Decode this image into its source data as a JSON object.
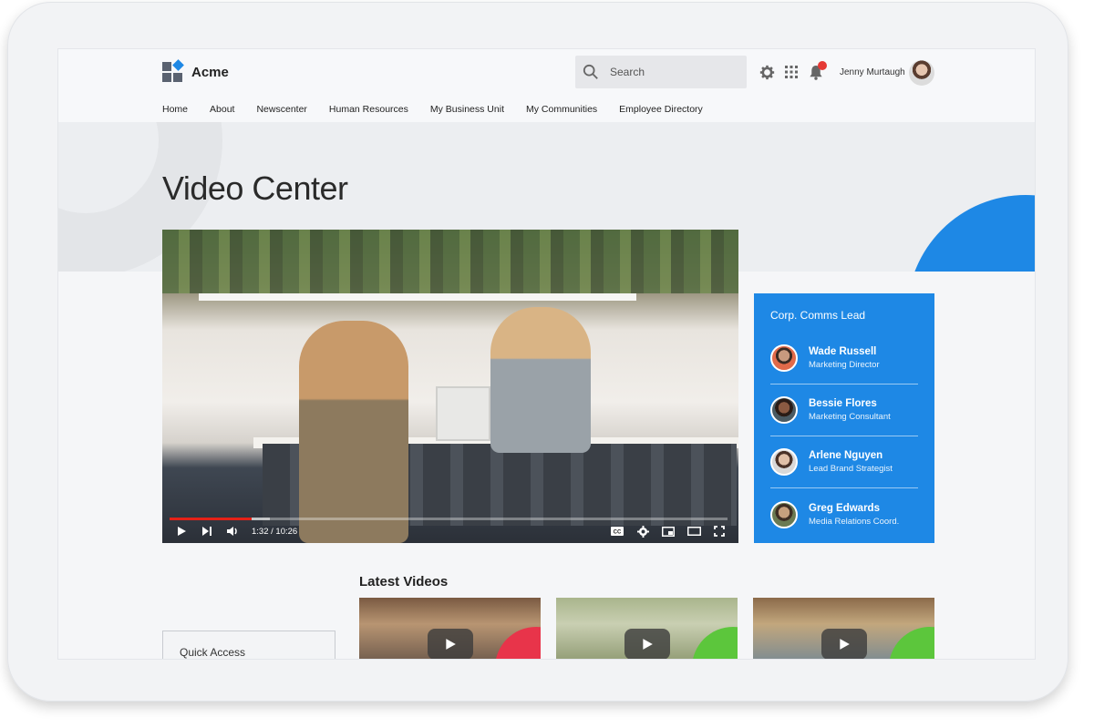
{
  "app": {
    "name": "Acme"
  },
  "search": {
    "placeholder": "Search"
  },
  "user": {
    "name": "Jenny Murtaugh"
  },
  "nav": [
    "Home",
    "About",
    "Newscenter",
    "Human Resources",
    "My Business Unit",
    "My Communities",
    "Employee Directory"
  ],
  "page": {
    "title": "Video Center"
  },
  "video": {
    "time": "1:32 / 10:26",
    "progress": 0.147
  },
  "contacts": {
    "heading": "Corp. Comms Lead",
    "people": [
      {
        "name": "Wade Russell",
        "role": "Marketing Director"
      },
      {
        "name": "Bessie Flores",
        "role": "Marketing Consultant"
      },
      {
        "name": "Arlene Nguyen",
        "role": "Lead Brand Strategist"
      },
      {
        "name": "Greg Edwards",
        "role": "Media Relations Coord."
      }
    ]
  },
  "latest": {
    "title": "Latest Videos"
  },
  "quick_access": {
    "label": "Quick Access"
  },
  "colors": {
    "accent": "#1e88e5",
    "notification": "#e53935",
    "progress": "#e62117"
  }
}
